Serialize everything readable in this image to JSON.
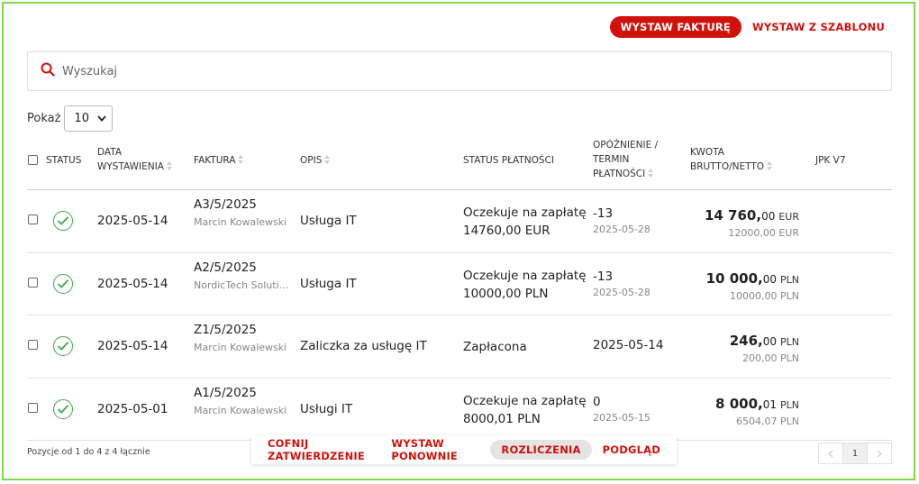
{
  "toolbar": {
    "issue_invoice": "WYSTAW FAKTURĘ",
    "from_template": "WYSTAW Z SZABLONU"
  },
  "search": {
    "placeholder": "Wyszukaj"
  },
  "page_size": {
    "label": "Pokaż",
    "value": "10"
  },
  "headers": {
    "status": "STATUS",
    "issue_date_1": "DATA",
    "issue_date_2": "WYSTAWIENIA",
    "invoice": "FAKTURA",
    "description": "OPIS",
    "payment_status": "STATUS PŁATNOŚCI",
    "delay_1": "OPÓŹNIENIE /",
    "delay_2": "TERMIN",
    "delay_3": "PŁATNOŚCI",
    "amount_1": "KWOTA",
    "amount_2": "BRUTTO/NETTO",
    "jpk": "JPK V7"
  },
  "rows": [
    {
      "date": "2025-05-14",
      "invoice": "A3/5/2025",
      "client": "Marcin Kowalewski",
      "description": "Usługa IT",
      "pay1": "Oczekuje na zapłatę",
      "pay2": "14760,00 EUR",
      "delay": "-13",
      "due": "2025-05-28",
      "gross_int": "14 760,",
      "gross_dec": "00",
      "currency": "EUR",
      "net": "12000,00 EUR"
    },
    {
      "date": "2025-05-14",
      "invoice": "A2/5/2025",
      "client": "NordicTech Soluti...",
      "description": "Usługa IT",
      "pay1": "Oczekuje na zapłatę",
      "pay2": "10000,00 PLN",
      "delay": "-13",
      "due": "2025-05-28",
      "gross_int": "10 000,",
      "gross_dec": "00",
      "currency": "PLN",
      "net": "10000,00 PLN"
    },
    {
      "date": "2025-05-14",
      "invoice": "Z1/5/2025",
      "client": "Marcin Kowalewski",
      "description": "Zaliczka za usługę IT",
      "pay1": "Zapłacona",
      "pay2": "",
      "delay": "2025-05-14",
      "due": "",
      "gross_int": "246,",
      "gross_dec": "00",
      "currency": "PLN",
      "net": "200,00 PLN"
    },
    {
      "date": "2025-05-01",
      "invoice": "A1/5/2025",
      "client": "Marcin Kowalewski",
      "description": "Usługi IT",
      "pay1": "Oczekuje na zapłatę",
      "pay2": "8000,01 PLN",
      "delay": "0",
      "due": "2025-05-15",
      "gross_int": "8 000,",
      "gross_dec": "01",
      "currency": "PLN",
      "net": "6504,07 PLN"
    }
  ],
  "footer": {
    "info": "Pozycje od 1 do 4 z 4 łącznie",
    "page": "1"
  },
  "actions": {
    "undo_approval": "COFNIJ ZATWIERDZENIE",
    "reissue": "WYSTAW PONOWNIE",
    "settlements": "ROZLICZENIA",
    "preview": "PODGLĄD"
  },
  "colors": {
    "accent": "#d0120b",
    "success": "#3aaa4a",
    "frame": "#7ed94a"
  },
  "icons": {
    "search": "search-icon",
    "status": "check-circle-icon",
    "sort": "sort-icon"
  }
}
